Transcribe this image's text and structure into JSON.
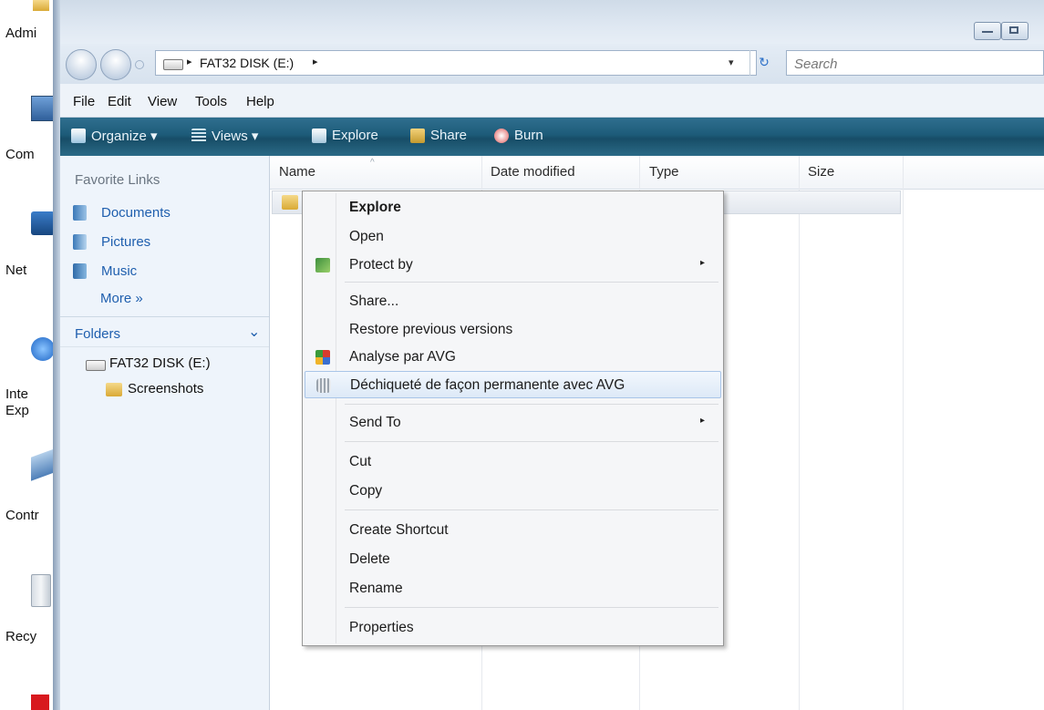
{
  "desktop": {
    "icons": [
      {
        "label": "Admi",
        "icon": "user-folder-icon"
      },
      {
        "label": "Com",
        "icon": "computer-icon"
      },
      {
        "label": "Net",
        "icon": "network-icon"
      },
      {
        "label": "Inte",
        "label2": "Exp",
        "icon": "internet-explorer-icon"
      },
      {
        "label": "Contr",
        "icon": "control-panel-icon"
      },
      {
        "label": "Recy",
        "icon": "recycle-bin-icon"
      }
    ]
  },
  "address_bar": {
    "crumb_sep": "▸",
    "path": "FAT32 DISK (E:)",
    "dropdown": "▾",
    "refresh": "↻",
    "search_placeholder": "Search"
  },
  "menubar": [
    "File",
    "Edit",
    "View",
    "Tools",
    "Help"
  ],
  "toolbar": {
    "organize": "Organize ▾",
    "views": "Views ▾",
    "explore": "Explore",
    "share": "Share",
    "burn": "Burn"
  },
  "nav_pane": {
    "favorite_links_title": "Favorite Links",
    "links": [
      "Documents",
      "Pictures",
      "Music"
    ],
    "more": "More »",
    "folders_label": "Folders",
    "folders_chevron": "⌄",
    "tree": [
      {
        "label": "FAT32 DISK (E:)",
        "icon": "drive-icon"
      },
      {
        "label": "Screenshots",
        "icon": "folder-icon"
      }
    ]
  },
  "file_list": {
    "columns": [
      "Name",
      "Date modified",
      "Type",
      "Size"
    ],
    "sort_indicator": "^"
  },
  "context_menu": {
    "items": [
      {
        "label": "Explore",
        "bold": true
      },
      {
        "label": "Open"
      },
      {
        "label": "Protect by",
        "icon": "protect-icon",
        "submenu": true
      },
      {
        "label": "Share..."
      },
      {
        "label": "Restore previous versions"
      },
      {
        "label": "Analyse par AVG",
        "icon": "avg-icon"
      },
      {
        "label": "Déchiqueté de façon permanente avec AVG",
        "icon": "shredder-icon",
        "highlighted": true
      },
      {
        "label": "Send To",
        "submenu": true
      },
      {
        "label": "Cut"
      },
      {
        "label": "Copy"
      },
      {
        "label": "Create Shortcut"
      },
      {
        "label": "Delete"
      },
      {
        "label": "Rename"
      },
      {
        "label": "Properties"
      }
    ],
    "submenu_arrow": "▸"
  },
  "colors": {
    "toolbar_bg": "#1d5b79",
    "link_blue": "#1f5fae",
    "highlight_bg": "#dde9f7"
  }
}
